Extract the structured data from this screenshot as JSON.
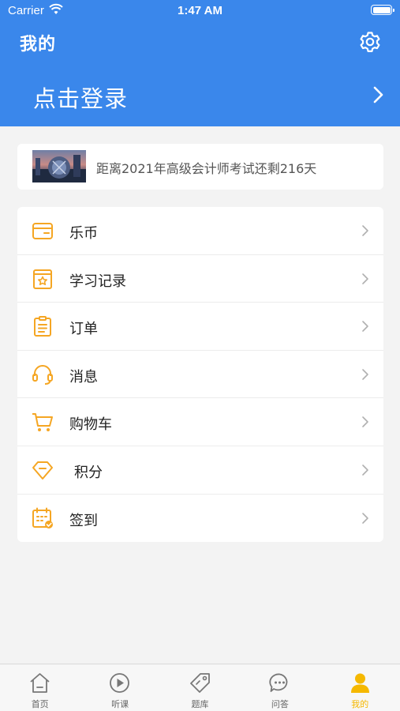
{
  "status_bar": {
    "carrier": "Carrier",
    "time": "1:47 AM"
  },
  "header": {
    "title": "我的",
    "login_label": "点击登录",
    "settings_icon": "gear-icon"
  },
  "exam_banner": {
    "text": "距离2021年高级会计师考试还剩216天"
  },
  "menu": {
    "items": [
      {
        "label": "乐币",
        "icon": "wallet-icon"
      },
      {
        "label": "学习记录",
        "icon": "study-record-icon"
      },
      {
        "label": "订单",
        "icon": "clipboard-icon"
      },
      {
        "label": "消息",
        "icon": "headset-icon"
      },
      {
        "label": "购物车",
        "icon": "cart-icon"
      },
      {
        "label": "积分",
        "icon": "diamond-icon"
      },
      {
        "label": "签到",
        "icon": "calendar-check-icon"
      }
    ]
  },
  "tabbar": {
    "tabs": [
      {
        "label": "首页",
        "icon": "home-icon"
      },
      {
        "label": "听课",
        "icon": "play-icon"
      },
      {
        "label": "题库",
        "icon": "tag-icon"
      },
      {
        "label": "问答",
        "icon": "chat-icon"
      },
      {
        "label": "我的",
        "icon": "user-icon",
        "active": true
      }
    ]
  },
  "colors": {
    "primary": "#3a87eb",
    "accent": "#f5a623",
    "active_tab": "#f5b800",
    "background": "#f3f3f3"
  }
}
